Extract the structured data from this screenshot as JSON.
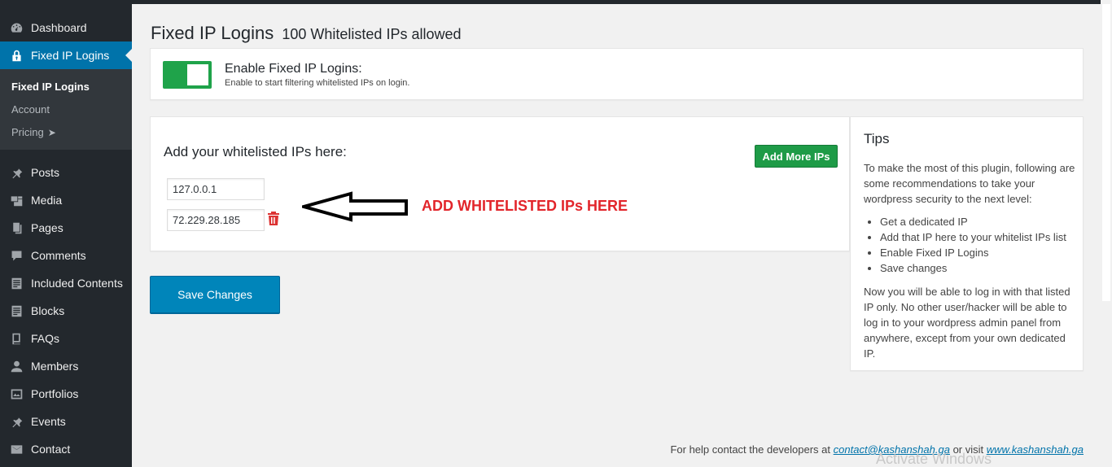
{
  "sidebar": {
    "items": [
      {
        "label": "Dashboard",
        "icon": "dashboard-icon"
      },
      {
        "label": "Fixed IP Logins",
        "icon": "lock-icon"
      },
      {
        "label": "Posts",
        "icon": "pin-icon"
      },
      {
        "label": "Media",
        "icon": "media-icon"
      },
      {
        "label": "Pages",
        "icon": "pages-icon"
      },
      {
        "label": "Comments",
        "icon": "comment-icon"
      },
      {
        "label": "Included Contents",
        "icon": "document-icon"
      },
      {
        "label": "Blocks",
        "icon": "document-icon"
      },
      {
        "label": "FAQs",
        "icon": "book-icon"
      },
      {
        "label": "Members",
        "icon": "user-icon"
      },
      {
        "label": "Portfolios",
        "icon": "portfolio-icon"
      },
      {
        "label": "Events",
        "icon": "pin-icon"
      },
      {
        "label": "Contact",
        "icon": "mail-icon"
      }
    ],
    "submenu": [
      "Fixed IP Logins",
      "Account",
      "Pricing"
    ],
    "pricing_arrow": "➤"
  },
  "page": {
    "title": "Fixed IP Logins",
    "subtitle": "100 Whitelisted IPs allowed"
  },
  "toggle": {
    "title": "Enable Fixed IP Logins:",
    "description": "Enable to start filtering whitelisted IPs on login.",
    "enabled": true,
    "color": "#1fa34a"
  },
  "whitelist": {
    "heading": "Add your whitelisted IPs here:",
    "add_button": "Add More IPs",
    "ips": [
      "127.0.0.1",
      "72.229.28.185"
    ],
    "annotation": "ADD WHITELISTED IPs HERE"
  },
  "save_button": "Save Changes",
  "tips": {
    "title": "Tips",
    "intro": "To make the most of this plugin, following are some recommendations to take your wordpress security to the next level:",
    "list": [
      "Get a dedicated IP",
      "Add that IP here to your whitelist IPs list",
      "Enable Fixed IP Logins",
      "Save changes"
    ],
    "outro": "Now you will be able to log in with that listed IP only. No other user/hacker will be able to log in to your wordpress admin panel from anywhere, except from your own dedicated IP."
  },
  "footer": {
    "prefix": "For help contact the developers at",
    "email": "contact@kashanshah.ga",
    "middle": "or visit",
    "website": "www.kashanshah.ga"
  },
  "watermark": "Activate Windows",
  "colors": {
    "sidebar_bg": "#23282d",
    "active_bg": "#0073aa",
    "primary_button": "#0085ba",
    "add_button": "#1e9b47",
    "annotation": "#e2252b"
  }
}
